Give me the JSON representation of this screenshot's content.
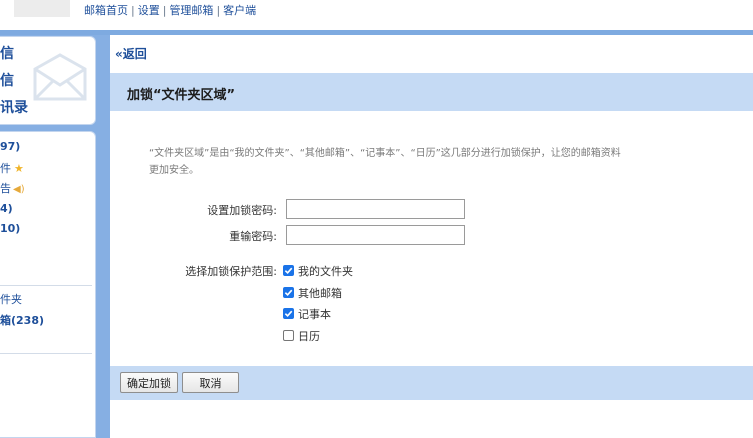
{
  "topnav": {
    "links": [
      "邮箱首页",
      "设置",
      "管理邮箱",
      "客户端"
    ],
    "separator": "|"
  },
  "sidebar": {
    "quick_items": [
      "信",
      "信",
      "讯录"
    ],
    "folders": [
      {
        "label": "97)",
        "bold": true
      },
      {
        "label": "件",
        "icon": "star-icon"
      },
      {
        "label": "告",
        "icon": "speaker-icon"
      },
      {
        "label": "4)",
        "bold": true
      },
      {
        "label": "10)",
        "bold": true
      }
    ],
    "other_folders": [
      {
        "label": "件夹",
        "bold": false
      },
      {
        "label": "箱(238)",
        "bold": true
      }
    ]
  },
  "main": {
    "back_link": "«返回",
    "title": "加锁“文件夹区域”",
    "description": "“文件夹区域”是由“我的文件夹”、“其他邮箱”、“记事本”、“日历”这几部分进行加锁保护，让您的邮箱资料更加安全。",
    "form": {
      "password_label": "设置加锁密码:",
      "password_value": "",
      "confirm_label": "重输密码:",
      "confirm_value": "",
      "scope_label": "选择加锁保护范围:",
      "scope_options": [
        {
          "label": "我的文件夹",
          "checked": true
        },
        {
          "label": "其他邮箱",
          "checked": true
        },
        {
          "label": "记事本",
          "checked": true
        },
        {
          "label": "日历",
          "checked": false
        }
      ]
    },
    "buttons": {
      "confirm": "确定加锁",
      "cancel": "取消"
    }
  },
  "colors": {
    "brand_blue": "#1e4f9a",
    "header_band": "#c5daf4",
    "sidebar_bg": "#86afe3",
    "checkbox_accent": "#1a73e8",
    "star": "#f0b429"
  }
}
